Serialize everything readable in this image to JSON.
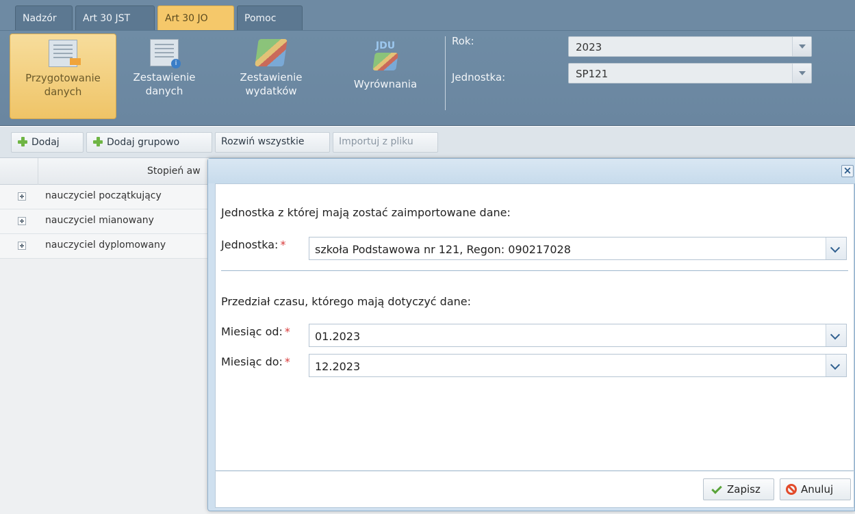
{
  "tabs": [
    {
      "label": "Nadzór",
      "active": false
    },
    {
      "label": "Art 30 JST",
      "active": false
    },
    {
      "label": "Art 30 JO",
      "active": true
    },
    {
      "label": "Pomoc",
      "active": false
    }
  ],
  "ribbon": {
    "buttons": [
      {
        "label": "Przygotowanie danych",
        "icon": "data-entry-icon",
        "active": true
      },
      {
        "label": "Zestawienie danych",
        "icon": "report-info-icon",
        "active": false
      },
      {
        "label": "Zestawienie wydatków",
        "icon": "money-report-icon",
        "active": false
      },
      {
        "label": "Wyrównania",
        "icon": "jdu-money-icon",
        "active": false,
        "badge": "JDU"
      }
    ],
    "rok_label": "Rok:",
    "rok_value": "2023",
    "jednostka_label": "Jednostka:",
    "jednostka_value": "SP121"
  },
  "toolbar": {
    "add": "Dodaj",
    "add_group": "Dodaj grupowo",
    "expand_all": "Rozwiń wszystkie",
    "import": "Importuj z pliku"
  },
  "grid": {
    "column_header": "Stopień aw",
    "rows": [
      "nauczyciel początkujący",
      "nauczyciel mianowany",
      "nauczyciel dyplomowany"
    ]
  },
  "modal": {
    "close": "×",
    "source_heading": "Jednostka z której mają zostać zaimportowane dane:",
    "jednostka_label": "Jednostka:",
    "jednostka_value": "szkoła Podstawowa nr 121, Regon: 090217028",
    "period_heading": "Przedział czasu, którego mają dotyczyć dane:",
    "from_label": "Miesiąc od:",
    "from_value": "01.2023",
    "to_label": "Miesiąc do:",
    "to_value": "12.2023",
    "required_mark": "*",
    "save": "Zapisz",
    "cancel": "Anuluj"
  },
  "colors": {
    "header_blue": "#6e8aa3",
    "active_tab": "#f5c86a",
    "required": "#d83a3a",
    "ok_green": "#5aa43a",
    "cancel_red": "#e24a2a"
  }
}
